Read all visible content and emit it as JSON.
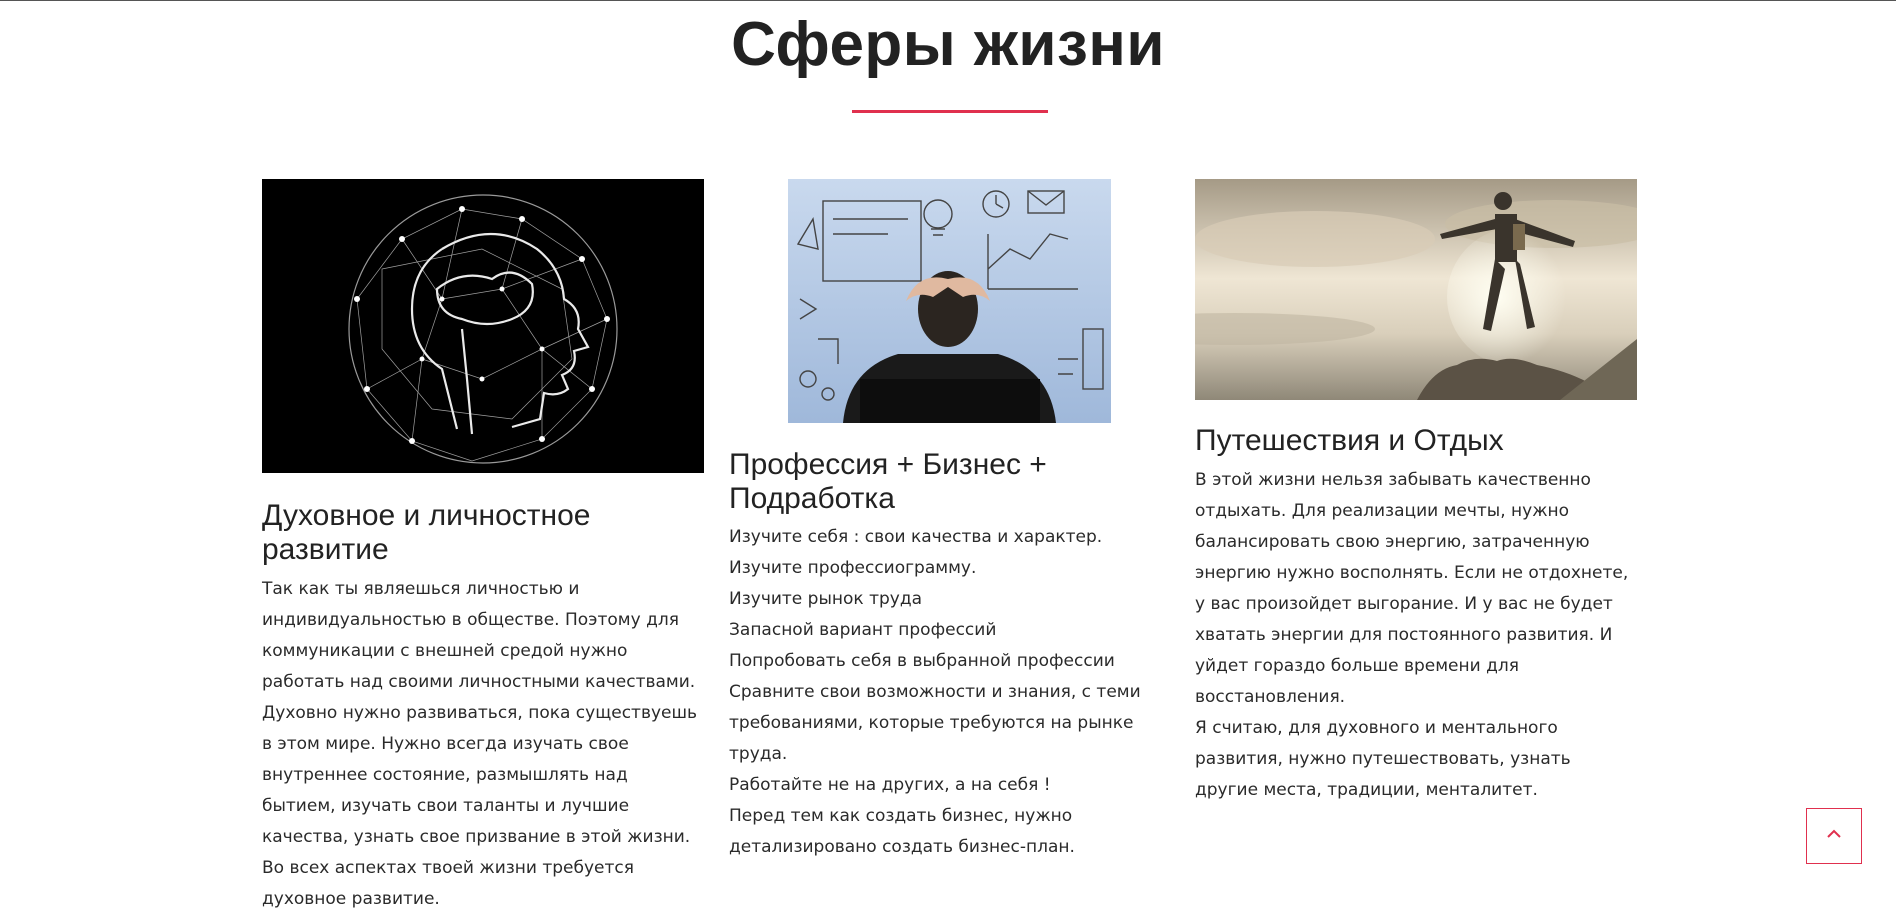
{
  "section": {
    "title": "Сферы жизни",
    "accent_color": "#e0304e"
  },
  "cards": [
    {
      "image_icon": "brain-network-illustration",
      "title": "Духовное и личностное развитие",
      "paragraphs": [
        "Так как ты являешься личностью и индивидуальностью в обществе. Поэтому для коммуникации с внешней средой нужно работать над своими личностными качествами.",
        "Духовно нужно развиваться, пока существуешь в этом мире. Нужно всегда изучать свое внутреннее состояние, размышлять над бытием, изучать свои таланты и лучшие качества, узнать свое призвание в этой жизни. Во всех аспектах твоей жизни требуется духовное развитие."
      ]
    },
    {
      "image_icon": "business-plan-woman-photo",
      "title": "Профессия + Бизнес + Подработка",
      "paragraphs": [
        "Изучите себя : свои качества и характер.",
        "Изучите профессиограмму.",
        "Изучите рынок труда",
        "Запасной вариант профессий",
        "Попробовать себя в выбранной профессии",
        "Сравните свои возможности и знания, с теми требованиями, которые требуются на рынке труда.",
        "Работайте не на других, а на себя !",
        "Перед тем как создать бизнес, нужно детализировано создать бизнес-план."
      ]
    },
    {
      "image_icon": "traveler-on-mountain-photo",
      "title": "Путешествия и Отдых",
      "paragraphs": [
        "В этой жизни нельзя забывать качественно отдыхать. Для реализации мечты, нужно балансировать свою энергию, затраченную энергию нужно восполнять. Если не отдохнете, у вас произойдет выгорание. И у вас не будет хватать энергии для постоянного развития. И уйдет гораздо больше времени для восстановления.",
        "Я считаю, для духовного и ментального развития, нужно путешествовать, узнать другие места, традиции, менталитет."
      ]
    }
  ],
  "scroll_top": {
    "icon": "chevron-up-icon"
  }
}
